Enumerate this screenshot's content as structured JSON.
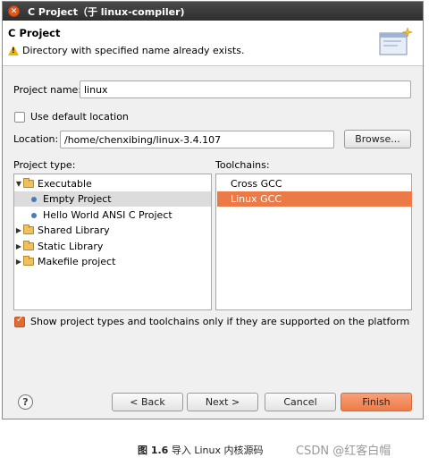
{
  "window": {
    "title": "C Project（于 linux-compiler)"
  },
  "header": {
    "title": "C Project",
    "message": "Directory with specified name already exists."
  },
  "form": {
    "project_name_label": "Project name:",
    "project_name_value": "linux",
    "use_default_label": "Use default location",
    "location_label": "Location:",
    "location_value": "/home/chenxibing/linux-3.4.107",
    "browse_label": "Browse..."
  },
  "project_type": {
    "label": "Project type:",
    "items": [
      {
        "label": "Executable",
        "kind": "folder",
        "expanded": true
      },
      {
        "label": "Empty Project",
        "kind": "leaf",
        "selected": true
      },
      {
        "label": "Hello World ANSI C Project",
        "kind": "leaf"
      },
      {
        "label": "Shared Library",
        "kind": "folder"
      },
      {
        "label": "Static Library",
        "kind": "folder"
      },
      {
        "label": "Makefile project",
        "kind": "folder"
      }
    ]
  },
  "toolchains": {
    "label": "Toolchains:",
    "items": [
      {
        "label": "Cross GCC"
      },
      {
        "label": "Linux GCC",
        "selected": true
      }
    ]
  },
  "filter": {
    "label": "Show project types and toolchains only if they are supported on the platform",
    "checked": true
  },
  "footer": {
    "help_label": "?",
    "back_label": "< Back",
    "next_label": "Next >",
    "cancel_label": "Cancel",
    "finish_label": "Finish"
  },
  "caption": {
    "label": "图 1.6",
    "text": "导入 Linux 内核源码"
  },
  "watermark": "CSDN @红客白帽",
  "colors": {
    "accent": "#ec7a46",
    "title_bar": "#3a3a3a",
    "warning": "#f0b400"
  }
}
